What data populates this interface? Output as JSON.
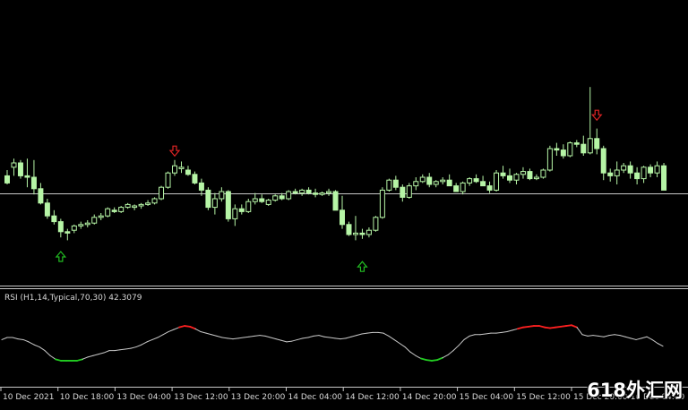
{
  "indicator": {
    "label": "RSI (H1,14,Typical,70,30) 42.3079",
    "overbought": 70,
    "oversold": 30
  },
  "time_axis": {
    "labels": [
      "10 Dec 2021",
      "10 Dec 18:00",
      "13 Dec 04:00",
      "13 Dec 12:00",
      "13 Dec 20:00",
      "14 Dec 04:00",
      "14 Dec 12:00",
      "14 Dec 20:00",
      "15 Dec 04:00",
      "15 Dec 12:00",
      "15 Dec 20:00",
      "16 Dec 04:00"
    ]
  },
  "watermark": "618外汇网",
  "colors": {
    "background": "#000000",
    "candle": "#b6f5a6",
    "grid_frame": "#c8c8c8",
    "rsi_line": "#c8c8c8",
    "rsi_overbought": "#ff2020",
    "rsi_oversold": "#22cc22",
    "arrow_down": "#e02424",
    "arrow_up": "#22bb22"
  },
  "chart_data": {
    "type": "candlestick",
    "price_ylim": [
      0,
      100
    ],
    "horizontal_level": 34,
    "candles": [
      [
        46,
        50,
        40,
        41
      ],
      [
        52,
        58,
        46,
        55
      ],
      [
        55,
        57,
        44,
        46
      ],
      [
        46,
        58,
        38,
        45
      ],
      [
        45,
        57,
        33,
        37
      ],
      [
        37,
        41,
        26,
        27
      ],
      [
        27,
        30,
        16,
        18
      ],
      [
        18,
        22,
        12,
        14
      ],
      [
        14,
        16,
        3,
        7
      ],
      [
        7,
        9,
        1,
        6
      ],
      [
        8,
        12,
        6,
        11
      ],
      [
        11,
        14,
        9,
        12
      ],
      [
        12,
        15,
        10,
        13
      ],
      [
        13,
        19,
        12,
        17
      ],
      [
        17,
        20,
        15,
        18
      ],
      [
        18,
        24,
        17,
        23
      ],
      [
        22,
        24,
        20,
        21
      ],
      [
        21,
        25,
        20,
        24
      ],
      [
        24,
        27,
        23,
        26
      ],
      [
        24,
        26,
        22,
        25
      ],
      [
        25,
        27,
        23,
        26
      ],
      [
        26,
        29,
        25,
        27
      ],
      [
        27,
        31,
        26,
        30
      ],
      [
        30,
        39,
        29,
        38
      ],
      [
        38,
        49,
        37,
        48
      ],
      [
        48,
        57,
        46,
        53
      ],
      [
        51,
        56,
        48,
        52
      ],
      [
        50,
        53,
        46,
        47
      ],
      [
        47,
        49,
        40,
        41
      ],
      [
        41,
        44,
        32,
        36
      ],
      [
        36,
        38,
        22,
        24
      ],
      [
        24,
        34,
        19,
        30
      ],
      [
        30,
        38,
        28,
        35
      ],
      [
        35,
        36,
        14,
        16
      ],
      [
        16,
        26,
        11,
        23
      ],
      [
        23,
        26,
        19,
        21
      ],
      [
        21,
        30,
        20,
        28
      ],
      [
        28,
        34,
        26,
        30
      ],
      [
        30,
        33,
        27,
        28
      ],
      [
        26,
        30,
        25,
        29
      ],
      [
        29,
        33,
        28,
        32
      ],
      [
        32,
        34,
        29,
        30
      ],
      [
        30,
        36,
        29,
        35
      ],
      [
        35,
        37,
        33,
        34
      ],
      [
        34,
        37,
        32,
        36
      ],
      [
        36,
        38,
        33,
        34
      ],
      [
        34,
        37,
        31,
        33
      ],
      [
        33,
        35,
        32,
        34
      ],
      [
        34,
        37,
        32,
        35
      ],
      [
        35,
        36,
        26,
        22
      ],
      [
        22,
        32,
        9,
        12
      ],
      [
        12,
        14,
        4,
        5
      ],
      [
        5,
        18,
        1,
        6
      ],
      [
        6,
        9,
        2,
        5
      ],
      [
        5,
        10,
        3,
        8
      ],
      [
        8,
        18,
        7,
        17
      ],
      [
        17,
        38,
        16,
        36
      ],
      [
        36,
        44,
        35,
        43
      ],
      [
        43,
        46,
        36,
        38
      ],
      [
        38,
        40,
        28,
        31
      ],
      [
        31,
        41,
        30,
        39
      ],
      [
        39,
        45,
        36,
        42
      ],
      [
        42,
        47,
        41,
        45
      ],
      [
        45,
        48,
        38,
        40
      ],
      [
        40,
        43,
        38,
        42
      ],
      [
        42,
        45,
        40,
        43
      ],
      [
        43,
        47,
        39,
        39
      ],
      [
        39,
        41,
        35,
        35
      ],
      [
        35,
        42,
        33,
        41
      ],
      [
        41,
        45,
        39,
        44
      ],
      [
        44,
        47,
        41,
        42
      ],
      [
        42,
        46,
        39,
        39
      ],
      [
        39,
        42,
        34,
        36
      ],
      [
        36,
        50,
        35,
        48
      ],
      [
        48,
        53,
        44,
        46
      ],
      [
        46,
        51,
        41,
        43
      ],
      [
        43,
        48,
        40,
        47
      ],
      [
        47,
        52,
        44,
        49
      ],
      [
        49,
        51,
        43,
        44
      ],
      [
        44,
        47,
        43,
        45
      ],
      [
        45,
        51,
        44,
        50
      ],
      [
        50,
        67,
        49,
        65
      ],
      [
        65,
        69,
        60,
        64
      ],
      [
        64,
        68,
        58,
        60
      ],
      [
        60,
        70,
        59,
        69
      ],
      [
        69,
        71,
        66,
        68
      ],
      [
        68,
        74,
        60,
        62
      ],
      [
        62,
        108,
        61,
        72
      ],
      [
        72,
        79,
        61,
        65
      ],
      [
        65,
        67,
        43,
        48
      ],
      [
        48,
        51,
        42,
        46
      ],
      [
        46,
        56,
        40,
        50
      ],
      [
        50,
        55,
        48,
        53
      ],
      [
        53,
        56,
        44,
        48
      ],
      [
        48,
        52,
        40,
        44
      ],
      [
        44,
        53,
        41,
        52
      ],
      [
        52,
        54,
        45,
        48
      ],
      [
        48,
        56,
        45,
        53
      ],
      [
        53,
        55,
        37,
        36
      ]
    ],
    "arrows": [
      {
        "type": "down",
        "candle": 25,
        "price": 63
      },
      {
        "type": "up",
        "candle": 8,
        "price": -10
      },
      {
        "type": "up",
        "candle": 53,
        "price": -17
      },
      {
        "type": "down",
        "candle": 88,
        "price": 88
      }
    ],
    "rsi": [
      55,
      58,
      58,
      56,
      55,
      52,
      48,
      45,
      40,
      33,
      28,
      26,
      26,
      26,
      26,
      28,
      31,
      33,
      35,
      37,
      40,
      40,
      41,
      42,
      43,
      45,
      48,
      52,
      55,
      58,
      62,
      66,
      69,
      72,
      74,
      73,
      70,
      66,
      64,
      62,
      60,
      58,
      57,
      56,
      57,
      58,
      59,
      60,
      61,
      60,
      58,
      56,
      54,
      52,
      53,
      55,
      57,
      58,
      60,
      61,
      59,
      58,
      57,
      56,
      57,
      59,
      61,
      63,
      64,
      65,
      65,
      64,
      60,
      55,
      50,
      45,
      38,
      33,
      29,
      27,
      26,
      27,
      30,
      34,
      40,
      47,
      55,
      60,
      62,
      62,
      63,
      64,
      64,
      65,
      66,
      68,
      70,
      72,
      73,
      74,
      74,
      72,
      71,
      72,
      73,
      74,
      75,
      72,
      62,
      60,
      61,
      60,
      59,
      61,
      62,
      61,
      59,
      57,
      55,
      57,
      59,
      55,
      50,
      46
    ]
  }
}
